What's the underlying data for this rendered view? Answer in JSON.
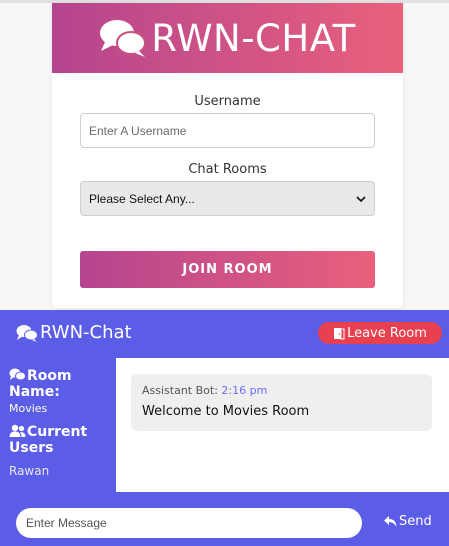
{
  "login": {
    "brand_title": "RWN-CHAT",
    "brand_icon": "comments-icon",
    "username_label": "Username",
    "username_placeholder": "Enter A Username",
    "username_value": "",
    "rooms_label": "Chat Rooms",
    "rooms_selected": "Please Select Any...",
    "join_label": "JOIN ROOM",
    "gradient_colors": [
      "#b5458f",
      "#e9607c"
    ]
  },
  "chat": {
    "logo_text": "RWN-Chat",
    "logo_icon": "comments-icon",
    "leave_label": "Leave Room",
    "leave_icon": "door-open-icon",
    "sidebar": {
      "room_heading": "Room Name:",
      "room_value": "Movies",
      "users_heading": "Current Users",
      "users": [
        "Rawan"
      ]
    },
    "messages": [
      {
        "author": "Assistant Bot:",
        "time": "2:16 pm",
        "text": "Welcome to Movies Room"
      }
    ],
    "input_placeholder": "Enter Message",
    "send_label": "Send",
    "send_icon": "reply-icon",
    "accent_color": "#5b5de6",
    "leave_color": "#e8404f"
  }
}
